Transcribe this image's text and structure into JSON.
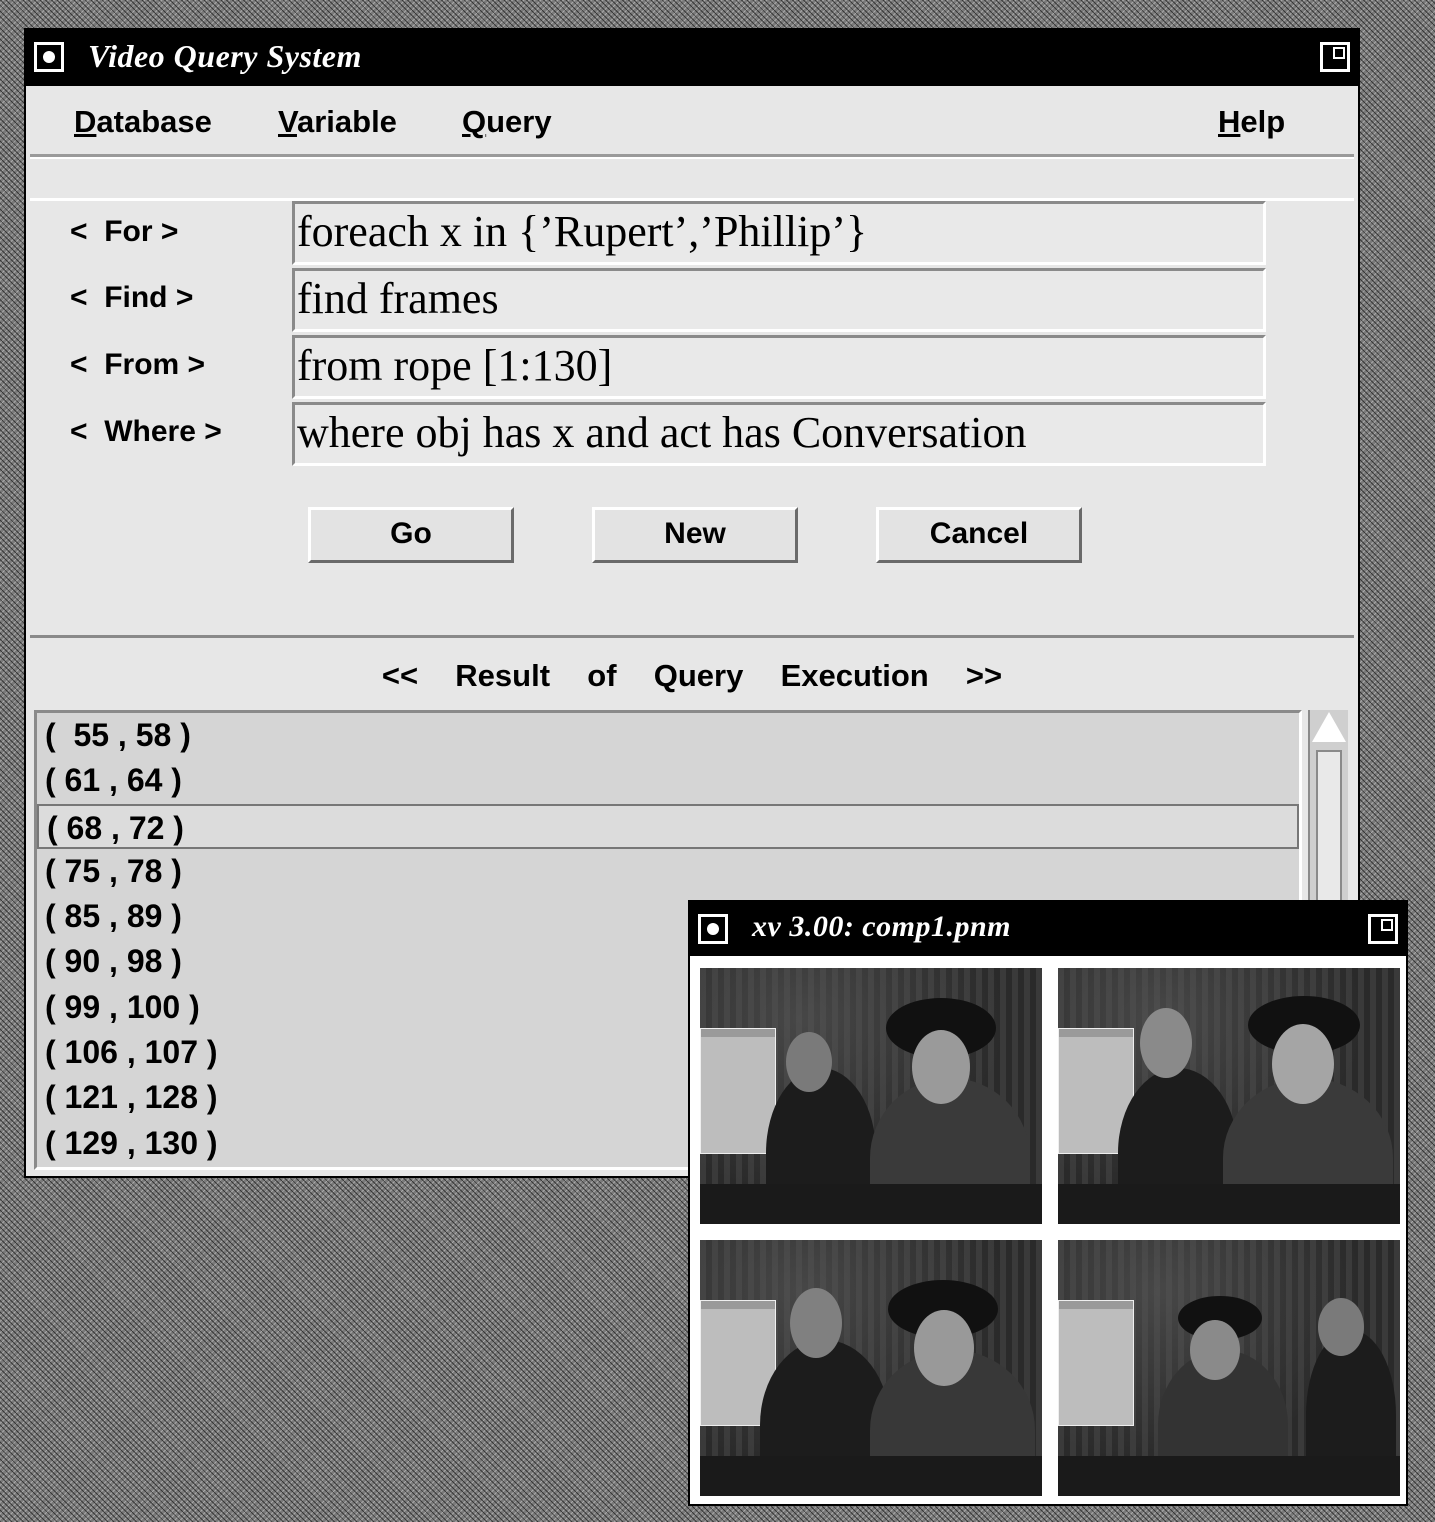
{
  "main_window": {
    "title": "Video Query System",
    "menu": {
      "database": {
        "u": "D",
        "rest": "atabase"
      },
      "variable": {
        "u": "V",
        "rest": "ariable"
      },
      "query": {
        "u": "Q",
        "rest": "uery"
      },
      "help": {
        "u": "H",
        "rest": "elp"
      }
    },
    "query_form": {
      "for_label": "<  For >",
      "find_label": "<  Find >",
      "from_label": "<  From >",
      "where_label": "<  Where >",
      "for_value": "foreach x in {’Rupert’,’Phillip’}",
      "find_value": "find frames",
      "from_value": "from rope [1:130]",
      "where_value": "where obj has x and act has Conversation"
    },
    "buttons": {
      "go": "Go",
      "new": "New",
      "cancel": "Cancel"
    },
    "results": {
      "title": "<<  Result  of  Query  Execution  >>",
      "rows": [
        "(  55 , 58 )",
        "( 61 , 64 )",
        "( 68 , 72 )",
        "( 75 , 78 )",
        "( 85 , 89 )",
        "( 90 , 98 )",
        "( 99 , 100 )",
        "( 106 , 107 )",
        "( 121 , 128 )",
        "( 129 , 130 )"
      ],
      "selected_index": 2
    }
  },
  "xv_window": {
    "title": "xv 3.00: comp1.pnm",
    "frames": [
      "frame-1",
      "frame-2",
      "frame-3",
      "frame-4"
    ]
  }
}
